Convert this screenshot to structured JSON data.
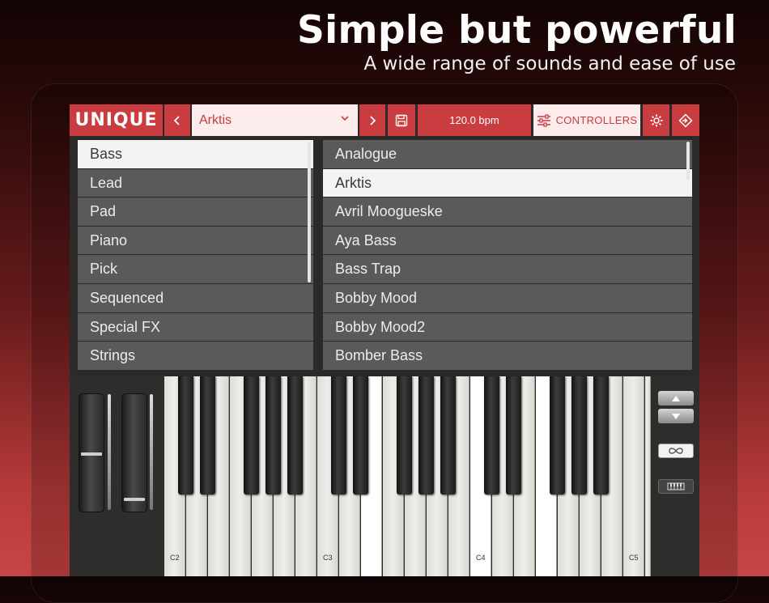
{
  "hero": {
    "title": "Simple but powerful",
    "subtitle": "A wide range of sounds and ease of use"
  },
  "toolbar": {
    "logo": "UNIQUE",
    "prev_icon": "chevron-left-icon",
    "preset_name": "Arktis",
    "next_icon": "chevron-right-icon",
    "save_icon": "floppy-disk-icon",
    "bpm": "120.0 bpm",
    "controllers_label": "CONTROLLERS",
    "settings_icon": "gear-icon",
    "routing_icon": "routing-icon"
  },
  "categories": {
    "selected": "Bass",
    "items": [
      "Bass",
      "Lead",
      "Pad",
      "Piano",
      "Pick",
      "Sequenced",
      "Special FX",
      "Strings"
    ]
  },
  "presets": {
    "selected": "Arktis",
    "items": [
      "Analogue",
      "Arktis",
      "Avril Moogueske",
      "Aya Bass",
      "Bass Trap",
      "Bobby Mood",
      "Bobby Mood2",
      "Bomber Bass"
    ]
  },
  "keyboard": {
    "octave_labels": [
      "C2",
      "C3",
      "C4",
      "C5"
    ],
    "octave_up_icon": "triangle-up-icon",
    "octave_down_icon": "triangle-down-icon",
    "hold_icon": "infinity-icon",
    "keyboard_icon": "keyboard-icon"
  },
  "colors": {
    "accent": "#c93c3f",
    "accent_light": "#fcecec",
    "list_bg": "#5b5a58",
    "panel_bg": "#2b2a29"
  }
}
